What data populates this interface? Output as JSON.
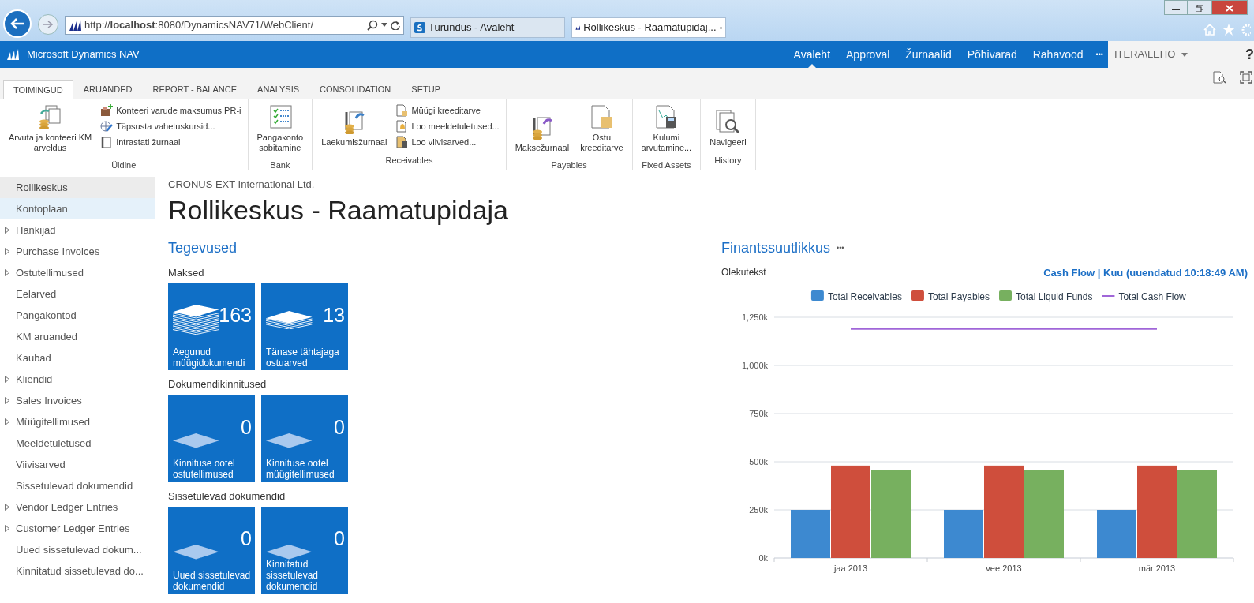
{
  "browser": {
    "address": "http://**localhost**:8080/DynamicsNAV71/WebClient/",
    "tabs": [
      {
        "title": "Turundus - Avaleht",
        "kind": "sharepoint",
        "selected": false
      },
      {
        "title": "Rollikeskus - Raamatupidaj...",
        "kind": "nav",
        "selected": true
      }
    ]
  },
  "app": {
    "title": "Microsoft Dynamics NAV",
    "nav": [
      {
        "label": "Avaleht",
        "selected": true
      },
      {
        "label": "Approval",
        "selected": false
      },
      {
        "label": "Žurnaalid",
        "selected": false
      },
      {
        "label": "Põhivarad",
        "selected": false
      },
      {
        "label": "Rahavood",
        "selected": false
      }
    ],
    "more": "•••",
    "user": "ITERA\\LEHO",
    "help": "?"
  },
  "ribbon": {
    "tabs": [
      {
        "label": "TOIMINGUD",
        "selected": true
      },
      {
        "label": "ARUANDED",
        "selected": false
      },
      {
        "label": "REPORT - BALANCE",
        "selected": false
      },
      {
        "label": "ANALYSIS",
        "selected": false
      },
      {
        "label": "CONSOLIDATION",
        "selected": false
      },
      {
        "label": "SETUP",
        "selected": false
      }
    ],
    "groups": [
      {
        "label": "Üldine",
        "items": [
          {
            "label": "Arvuta ja konteeri KM\narveldus",
            "kind": "large"
          },
          {
            "label": "Konteeri varude maksumus PR-i",
            "kind": "small"
          },
          {
            "label": "Täpsusta vahetuskursid...",
            "kind": "small"
          },
          {
            "label": "Intrastati žurnaal",
            "kind": "small"
          }
        ]
      },
      {
        "label": "Bank",
        "items": [
          {
            "label": "Pangakonto\nsobitamine",
            "kind": "large"
          }
        ]
      },
      {
        "label": "Receivables",
        "items": [
          {
            "label": "Laekumisžurnaal",
            "kind": "large"
          },
          {
            "label": "Müügi kreeditarve",
            "kind": "small"
          },
          {
            "label": "Loo meeldetuletused...",
            "kind": "small"
          },
          {
            "label": "Loo viivisarved...",
            "kind": "small"
          }
        ]
      },
      {
        "label": "Payables",
        "items": [
          {
            "label": "Maksežurnaal",
            "kind": "large"
          },
          {
            "label": "Ostu\nkreeditarve",
            "kind": "large"
          }
        ]
      },
      {
        "label": "Fixed Assets",
        "items": [
          {
            "label": "Kulumi\narvutamine...",
            "kind": "large"
          }
        ]
      },
      {
        "label": "History",
        "items": [
          {
            "label": "Navigeeri",
            "kind": "large"
          }
        ]
      }
    ]
  },
  "sidebar": {
    "items": [
      {
        "label": "Rollikeskus",
        "selected": true,
        "hovered": false,
        "expandable": false
      },
      {
        "label": "Kontoplaan",
        "selected": false,
        "hovered": true,
        "expandable": false
      },
      {
        "label": "Hankijad",
        "selected": false,
        "hovered": false,
        "expandable": true
      },
      {
        "label": "Purchase Invoices",
        "selected": false,
        "hovered": false,
        "expandable": true
      },
      {
        "label": "Ostutellimused",
        "selected": false,
        "hovered": false,
        "expandable": true
      },
      {
        "label": "Eelarved",
        "selected": false,
        "hovered": false,
        "expandable": false
      },
      {
        "label": "Pangakontod",
        "selected": false,
        "hovered": false,
        "expandable": false
      },
      {
        "label": "KM aruanded",
        "selected": false,
        "hovered": false,
        "expandable": false
      },
      {
        "label": "Kaubad",
        "selected": false,
        "hovered": false,
        "expandable": false
      },
      {
        "label": "Kliendid",
        "selected": false,
        "hovered": false,
        "expandable": true
      },
      {
        "label": "Sales Invoices",
        "selected": false,
        "hovered": false,
        "expandable": true
      },
      {
        "label": "Müügitellimused",
        "selected": false,
        "hovered": false,
        "expandable": true
      },
      {
        "label": "Meeldetuletused",
        "selected": false,
        "hovered": false,
        "expandable": false
      },
      {
        "label": "Viivisarved",
        "selected": false,
        "hovered": false,
        "expandable": false
      },
      {
        "label": "Sissetulevad dokumendid",
        "selected": false,
        "hovered": false,
        "expandable": false
      },
      {
        "label": "Vendor Ledger Entries",
        "selected": false,
        "hovered": false,
        "expandable": true
      },
      {
        "label": "Customer Ledger Entries",
        "selected": false,
        "hovered": false,
        "expandable": true
      },
      {
        "label": "Uued sissetulevad dokum...",
        "selected": false,
        "hovered": false,
        "expandable": false
      },
      {
        "label": "Kinnitatud sissetulevad do...",
        "selected": false,
        "hovered": false,
        "expandable": false
      }
    ]
  },
  "page": {
    "company": "CRONUS EXT International Ltd.",
    "title": "Rollikeskus - Raamatupidaja"
  },
  "activities": {
    "title": "Tegevused",
    "groups": [
      {
        "label": "Maksed",
        "tiles": [
          {
            "value": "163",
            "label": "Aegunud müügidokumendi",
            "kind": "tall"
          },
          {
            "value": "13",
            "label": "Tänase tähtajaga ostuarved",
            "kind": "short"
          }
        ]
      },
      {
        "label": "Dokumendikinnitused",
        "tiles": [
          {
            "value": "0",
            "label": "Kinnituse ootel ostutellimused",
            "kind": "flat"
          },
          {
            "value": "0",
            "label": "Kinnituse ootel müügitellimused",
            "kind": "flat"
          }
        ]
      },
      {
        "label": "Sissetulevad dokumendid",
        "tiles": [
          {
            "value": "0",
            "label": "Uued sissetulevad dokumendid",
            "kind": "flat"
          },
          {
            "value": "0",
            "label": "Kinnitatud sissetulevad dokumendid",
            "kind": "flat"
          }
        ]
      }
    ]
  },
  "finance": {
    "title": "Finantssuutlikkus",
    "menu": "•••",
    "status": "Olekutekst",
    "link": "Cash Flow | Kuu (uuendatud 10:18:49 AM)",
    "chart_data": {
      "type": "bar",
      "categories": [
        "jaa 2013",
        "vee 2013",
        "mär 2013"
      ],
      "series": [
        {
          "name": "Total Receivables",
          "color": "#3d89d0",
          "values": [
            250,
            250,
            250
          ]
        },
        {
          "name": "Total Payables",
          "color": "#cf4e3c",
          "values": [
            480,
            480,
            480
          ]
        },
        {
          "name": "Total Liquid Funds",
          "color": "#77b05f",
          "values": [
            455,
            455,
            455
          ]
        },
        {
          "name": "Total Cash Flow",
          "color": "#a066d8",
          "type": "line",
          "values": [
            1190,
            1190,
            1190
          ]
        }
      ],
      "ylim": [
        0,
        1250
      ],
      "grid": true,
      "legend": "top",
      "yticks": [
        {
          "value": 0,
          "label": "0k"
        },
        {
          "value": 250,
          "label": "250k"
        },
        {
          "value": 500,
          "label": "500k"
        },
        {
          "value": 750,
          "label": "750k"
        },
        {
          "value": 1000,
          "label": "1,000k"
        },
        {
          "value": 1250,
          "label": "1,250k"
        }
      ]
    }
  }
}
